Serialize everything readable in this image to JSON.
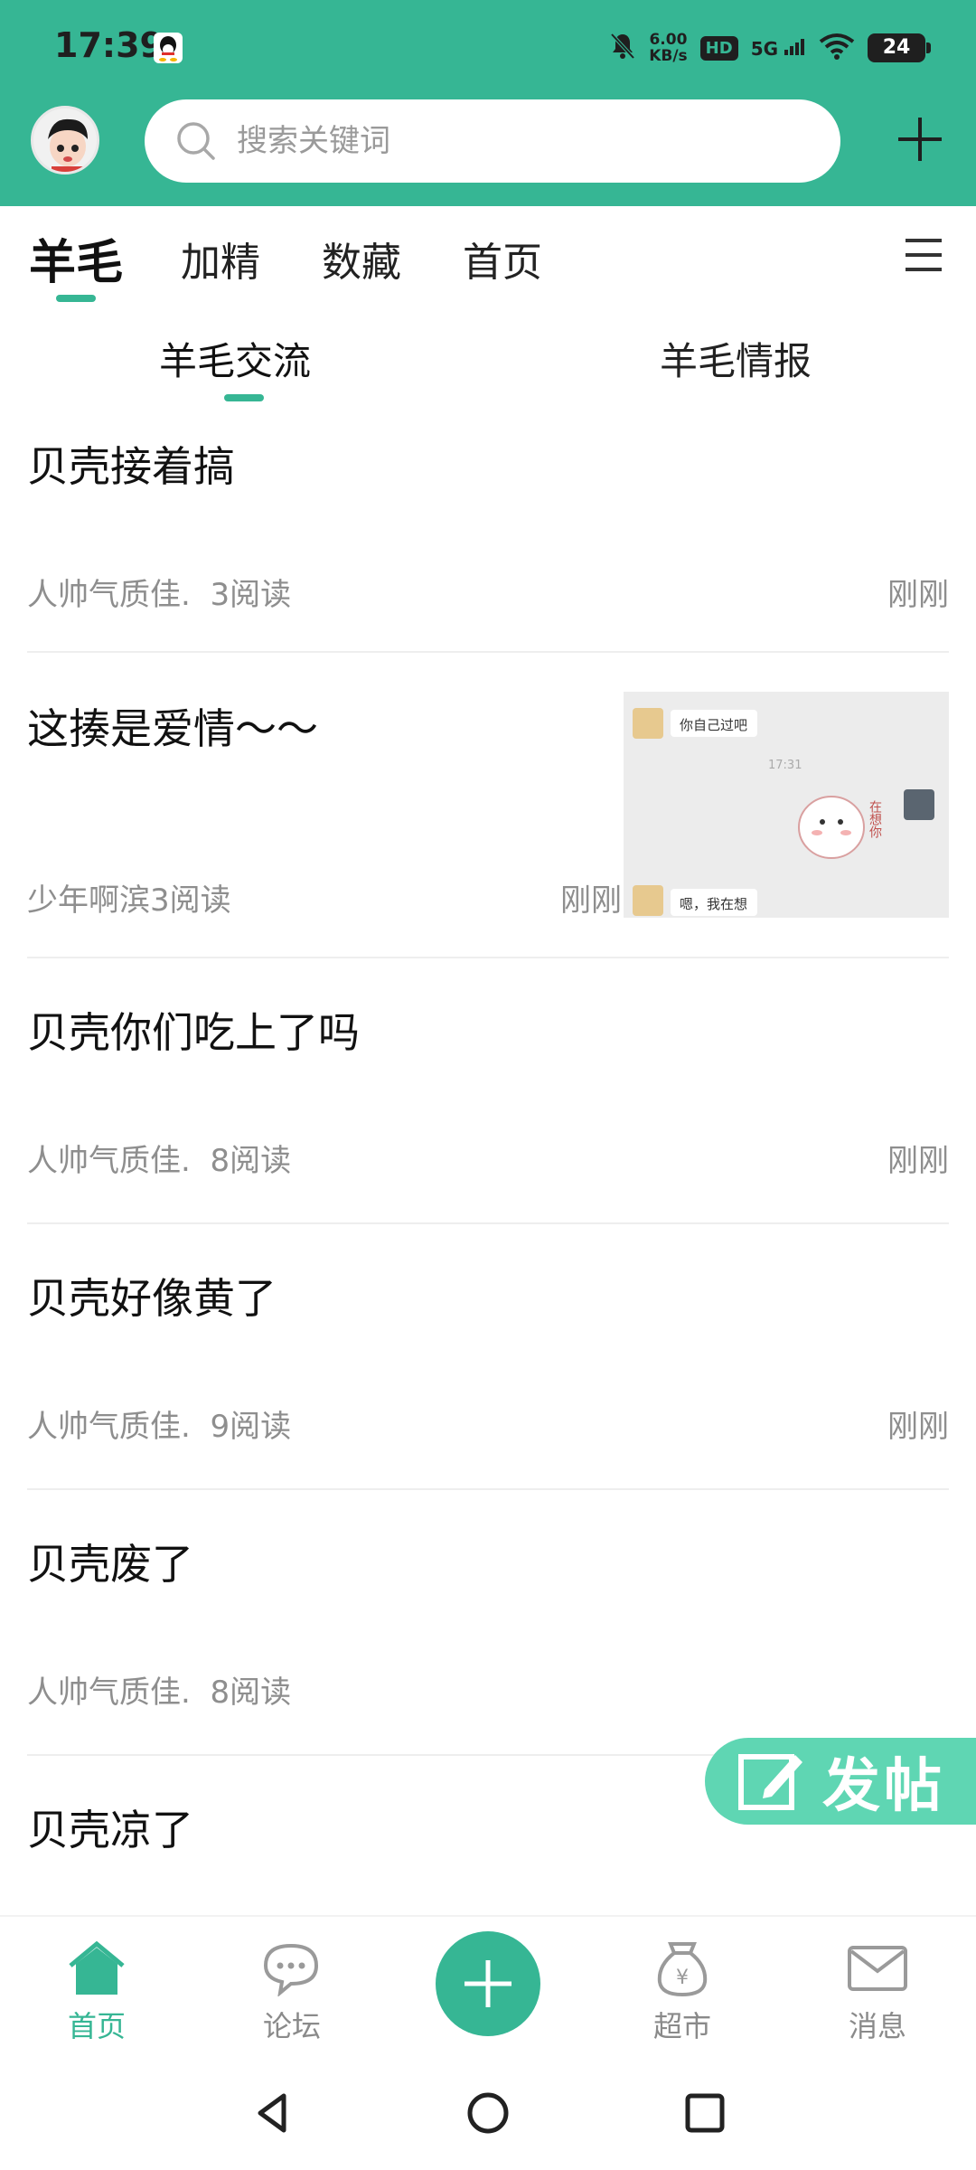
{
  "status": {
    "time": "17:39",
    "net_speed_value": "6.00",
    "net_speed_unit": "KB/s",
    "hd": "HD",
    "signal": "5G",
    "battery": "24"
  },
  "header": {
    "search_placeholder": "搜索关键词"
  },
  "tabs": [
    {
      "label": "羊毛",
      "active": true
    },
    {
      "label": "加精",
      "active": false
    },
    {
      "label": "数藏",
      "active": false
    },
    {
      "label": "首页",
      "active": false
    }
  ],
  "subtabs": [
    {
      "label": "羊毛交流",
      "active": true
    },
    {
      "label": "羊毛情报",
      "active": false
    }
  ],
  "posts": [
    {
      "title": "贝壳接着搞",
      "author": "人帅气质佳.",
      "reads": "3阅读",
      "time": "刚刚"
    },
    {
      "title": "这揍是爱情～～",
      "author": "少年啊滨",
      "reads": "3阅读",
      "time": "刚刚",
      "thumbnail": {
        "msg1": "你自己过吧",
        "time": "17:31",
        "msg2": "嗯，我在想",
        "sticker_text": "在想你"
      }
    },
    {
      "title": "贝壳你们吃上了吗",
      "author": "人帅气质佳.",
      "reads": "8阅读",
      "time": "刚刚"
    },
    {
      "title": "贝壳好像黄了",
      "author": "人帅气质佳.",
      "reads": "9阅读",
      "time": "刚刚"
    },
    {
      "title": "贝壳废了",
      "author": "人帅气质佳.",
      "reads": "8阅读",
      "time": ""
    },
    {
      "title": "贝壳凉了",
      "author": "",
      "reads": "",
      "time": ""
    }
  ],
  "fab": {
    "label": "发帖"
  },
  "bottom_nav": [
    {
      "label": "首页",
      "icon": "home-icon",
      "active": true
    },
    {
      "label": "论坛",
      "icon": "chat-bubble-icon",
      "active": false
    },
    {
      "label": "超市",
      "icon": "money-bag-icon",
      "active": false
    },
    {
      "label": "消息",
      "icon": "mail-icon",
      "active": false
    }
  ],
  "colors": {
    "primary": "#36b694",
    "fab": "#5fd6b3",
    "meta_text": "#8e8e8e"
  }
}
